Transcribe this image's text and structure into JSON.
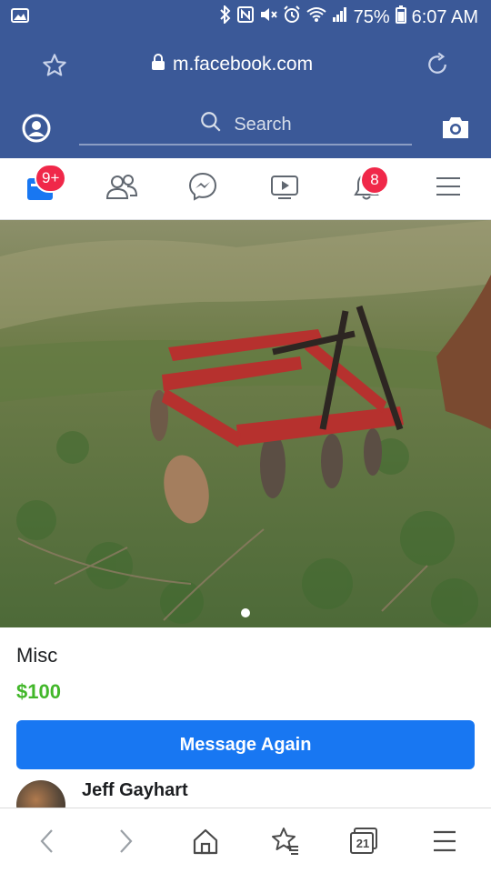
{
  "status_bar": {
    "battery": "75%",
    "time": "6:07 AM",
    "icons": [
      "image-icon",
      "bluetooth-icon",
      "nfc-icon",
      "mute-icon",
      "alarm-icon",
      "wifi-icon",
      "signal-icon",
      "battery-icon"
    ]
  },
  "browser": {
    "url": "m.facebook.com",
    "icons": [
      "star-icon",
      "lock-icon",
      "reload-icon"
    ]
  },
  "facebook_header": {
    "search_placeholder": "Search",
    "icons": [
      "profile-icon",
      "search-icon",
      "camera-icon"
    ]
  },
  "nav_tabs": [
    {
      "name": "home",
      "icon": "home-feed-icon",
      "badge": "9+"
    },
    {
      "name": "friends",
      "icon": "friends-icon",
      "badge": ""
    },
    {
      "name": "messenger",
      "icon": "messenger-icon",
      "badge": ""
    },
    {
      "name": "watch",
      "icon": "watch-icon",
      "badge": ""
    },
    {
      "name": "notifications",
      "icon": "bell-icon",
      "badge": "8"
    },
    {
      "name": "menu",
      "icon": "hamburger-icon",
      "badge": ""
    }
  ],
  "listing": {
    "title": "Misc",
    "price": "$100",
    "message_button": "Message Again",
    "seller_name": "Jeff Gayhart",
    "photo_index_dots": 1
  },
  "bottom_bar": {
    "tab_count": "21",
    "icons": [
      "back-icon",
      "forward-icon",
      "home-icon",
      "bookmarks-icon",
      "tabs-icon",
      "menu-icon"
    ]
  },
  "colors": {
    "facebook_blue": "#3b5998",
    "button_blue": "#1877f2",
    "price_green": "#42b72a",
    "badge_red": "#f02849"
  }
}
